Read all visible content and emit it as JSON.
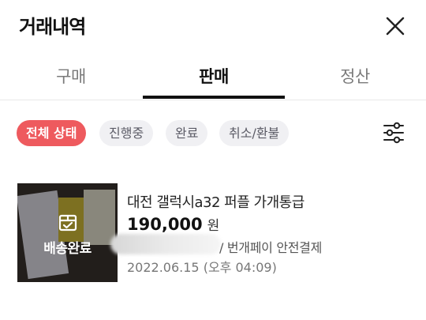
{
  "header": {
    "title": "거래내역",
    "close_icon": "close-icon"
  },
  "tabs": [
    {
      "label": "구매",
      "active": false
    },
    {
      "label": "판매",
      "active": true
    },
    {
      "label": "정산",
      "active": false
    }
  ],
  "filters": {
    "chips": [
      {
        "label": "전체 상태",
        "active": true
      },
      {
        "label": "진행중",
        "active": false
      },
      {
        "label": "완료",
        "active": false
      },
      {
        "label": "취소/환불",
        "active": false
      }
    ],
    "filter_icon": "sliders-icon"
  },
  "colors": {
    "accent": "#ee5a5e",
    "chip_bg": "#f0f0f3",
    "text_primary": "#111111",
    "text_secondary": "#777777"
  },
  "transactions": [
    {
      "status": "배송완료",
      "status_icon": "package-icon",
      "title": "대전 갤럭시a32 퍼플 가개통급",
      "price": "190,000",
      "currency": "원",
      "payment": "/ 번개페이 안전결제",
      "date": "2022.06.15 (오후 04:09)"
    }
  ]
}
